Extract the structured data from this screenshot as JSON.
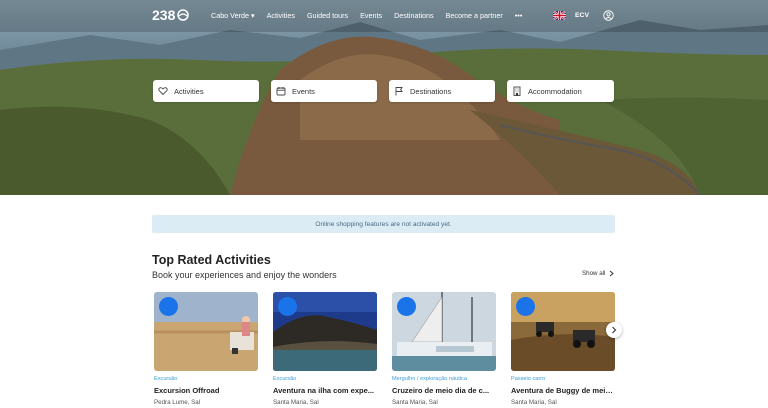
{
  "logo": {
    "text": "238"
  },
  "nav": {
    "items": [
      "Cabo Verde ▾",
      "Activities",
      "Guided tours",
      "Events",
      "Destinations",
      "Become a partner",
      "•••"
    ],
    "currency": "ECV"
  },
  "search_tabs": [
    {
      "label": "Activities",
      "icon": "heart-icon"
    },
    {
      "label": "Events",
      "icon": "calendar-icon"
    },
    {
      "label": "Destinations",
      "icon": "flag-icon"
    },
    {
      "label": "Accommodation",
      "icon": "building-icon"
    }
  ],
  "notice": "Online shopping features are not activated yet.",
  "section": {
    "title": "Top Rated Activities",
    "subtitle": "Book your experiences and enjoy the wonders",
    "show_all": "Show all"
  },
  "cards": [
    {
      "category": "Excursão",
      "title": "Excursion Offroad",
      "location": "Pedra Lume, Sal",
      "badge": ""
    },
    {
      "category": "Excursão",
      "title": "Aventura na ilha com expe...",
      "location": "Santa Maria, Sal",
      "badge": ""
    },
    {
      "category": "Mergulho / exploração náutica",
      "title": "Cruzeiro de meio dia de c...",
      "location": "Santa Maria, Sal",
      "badge": ""
    },
    {
      "category": "Passeio carro",
      "title": "Aventura de Buggy de meio...",
      "location": "Santa Maria, Sal",
      "badge": ""
    }
  ],
  "colors": {
    "accent": "#3a9bd5",
    "notice_bg": "#dcecf5",
    "badge": "#1a73e8"
  }
}
